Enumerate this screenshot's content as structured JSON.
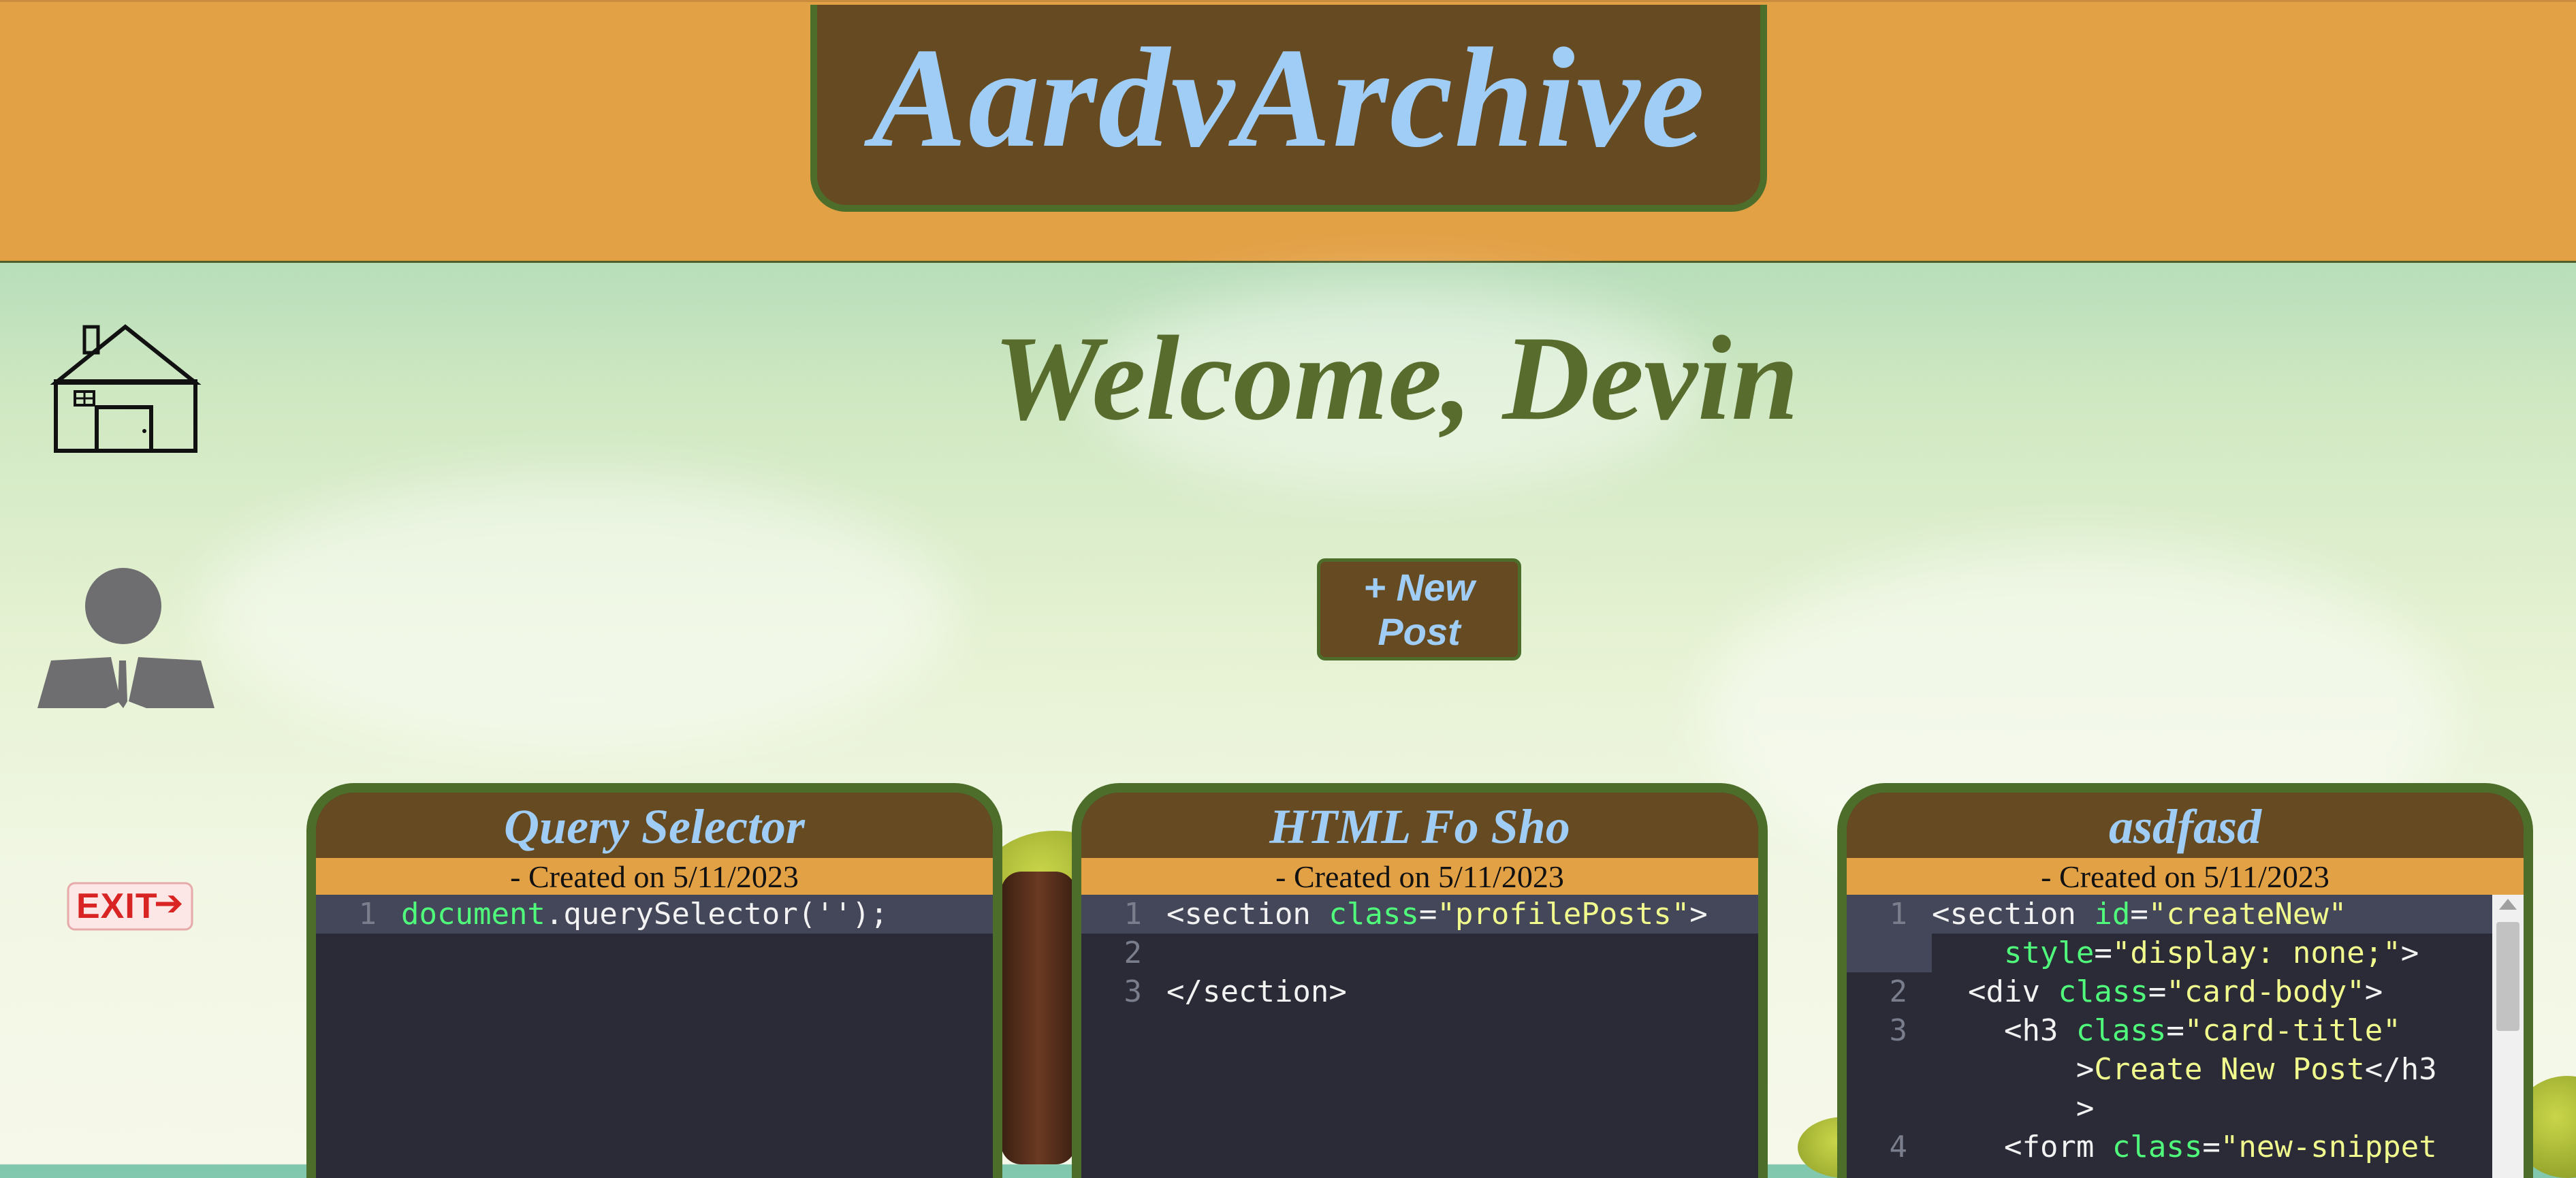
{
  "app": {
    "title": "AardvArchive"
  },
  "welcome": "Welcome, Devin",
  "new_post_label": "+ New Post",
  "nav": {
    "home_icon": "home-icon",
    "profile_icon": "profile-icon",
    "exit_icon": "exit-icon",
    "exit_label": "EXIT"
  },
  "colors": {
    "header": "#e3a146",
    "brown": "#664a22",
    "green": "#4d6e2a",
    "title_blue": "#9fcdf5",
    "welcome_green": "#586c2e",
    "code_bg": "#2b2b38"
  },
  "cards": [
    {
      "title": "Query Selector",
      "created": "- Created on 5/11/2023",
      "lines": [
        {
          "num": "1",
          "tokens": [
            {
              "t": "document",
              "c": "tok-attr"
            },
            {
              "t": ".querySelector('');",
              "c": "tok-plain"
            }
          ]
        }
      ]
    },
    {
      "title": "HTML Fo Sho",
      "created": "- Created on 5/11/2023",
      "lines": [
        {
          "num": "1",
          "tokens": [
            {
              "t": "<section ",
              "c": "tok-plain"
            },
            {
              "t": "class",
              "c": "tok-attr"
            },
            {
              "t": "=",
              "c": "tok-plain"
            },
            {
              "t": "\"profilePosts\"",
              "c": "tok-str"
            },
            {
              "t": ">",
              "c": "tok-plain"
            }
          ]
        },
        {
          "num": "2",
          "tokens": []
        },
        {
          "num": "3",
          "tokens": [
            {
              "t": "</section>",
              "c": "tok-plain"
            }
          ]
        }
      ]
    },
    {
      "title": "asdfasd",
      "created": "- Created on 5/11/2023",
      "lines": [
        {
          "num": "1",
          "tokens": [
            {
              "t": "<section ",
              "c": "tok-plain"
            },
            {
              "t": "id",
              "c": "tok-attr"
            },
            {
              "t": "=",
              "c": "tok-plain"
            },
            {
              "t": "\"createNew\"",
              "c": "tok-str"
            }
          ]
        },
        {
          "num": "",
          "tokens": [
            {
              "t": "    style",
              "c": "tok-attr"
            },
            {
              "t": "=",
              "c": "tok-plain"
            },
            {
              "t": "\"display: none;\"",
              "c": "tok-str"
            },
            {
              "t": ">",
              "c": "tok-plain"
            }
          ]
        },
        {
          "num": "2",
          "tokens": [
            {
              "t": "  <div ",
              "c": "tok-plain"
            },
            {
              "t": "class",
              "c": "tok-attr"
            },
            {
              "t": "=",
              "c": "tok-plain"
            },
            {
              "t": "\"card-body\"",
              "c": "tok-str"
            },
            {
              "t": ">",
              "c": "tok-plain"
            }
          ]
        },
        {
          "num": "3",
          "tokens": [
            {
              "t": "    <h3 ",
              "c": "tok-plain"
            },
            {
              "t": "class",
              "c": "tok-attr"
            },
            {
              "t": "=",
              "c": "tok-plain"
            },
            {
              "t": "\"card-title\"",
              "c": "tok-str"
            }
          ]
        },
        {
          "num": "",
          "tokens": [
            {
              "t": "        >",
              "c": "tok-plain"
            },
            {
              "t": "Create New Post",
              "c": "tok-str"
            },
            {
              "t": "</h3",
              "c": "tok-plain"
            }
          ]
        },
        {
          "num": "",
          "tokens": [
            {
              "t": "        >",
              "c": "tok-plain"
            }
          ]
        },
        {
          "num": "4",
          "tokens": [
            {
              "t": "    <form ",
              "c": "tok-plain"
            },
            {
              "t": "class",
              "c": "tok-attr"
            },
            {
              "t": "=",
              "c": "tok-plain"
            },
            {
              "t": "\"new-snippet",
              "c": "tok-str"
            }
          ]
        }
      ]
    }
  ]
}
